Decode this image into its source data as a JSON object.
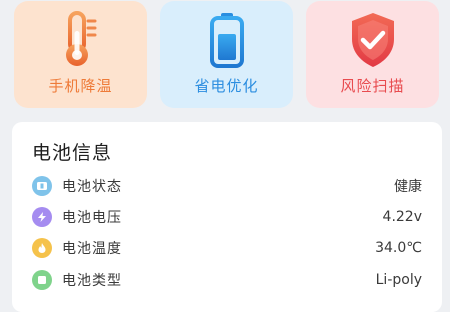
{
  "tiles": [
    {
      "label": "手机降温",
      "icon": "thermometer-icon",
      "bg": "#fde3cf",
      "fg": "#ee7b39"
    },
    {
      "label": "省电优化",
      "icon": "battery-icon",
      "bg": "#d9eefc",
      "fg": "#2c8ee0"
    },
    {
      "label": "风险扫描",
      "icon": "shield-check-icon",
      "bg": "#fde0e2",
      "fg": "#e84b4f"
    }
  ],
  "battery_info": {
    "title": "电池信息",
    "rows": [
      {
        "label": "电池状态",
        "value": "健康",
        "icon": "battery-status-icon",
        "color": "#7fc3ea"
      },
      {
        "label": "电池电压",
        "value": "4.22v",
        "icon": "lightning-icon",
        "color": "#a58cf0"
      },
      {
        "label": "电池温度",
        "value": "34.0℃",
        "icon": "flame-icon",
        "color": "#f5c24b"
      },
      {
        "label": "电池类型",
        "value": "Li-poly",
        "icon": "battery-type-icon",
        "color": "#7fd38b"
      }
    ]
  }
}
